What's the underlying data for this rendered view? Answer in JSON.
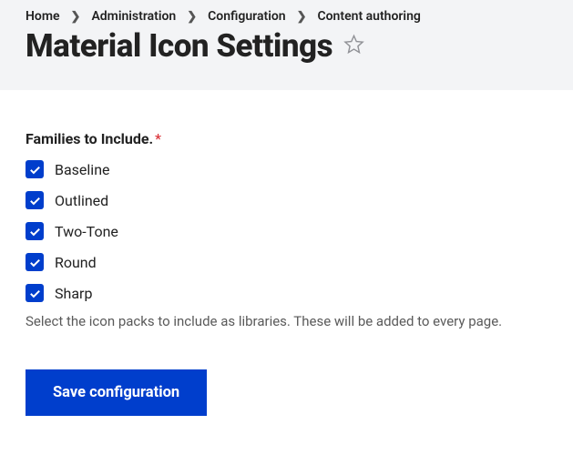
{
  "breadcrumb": [
    "Home",
    "Administration",
    "Configuration",
    "Content authoring"
  ],
  "page_title": "Material Icon Settings",
  "form": {
    "families_label": "Families to Include.",
    "options": [
      {
        "label": "Baseline",
        "checked": true
      },
      {
        "label": "Outlined",
        "checked": true
      },
      {
        "label": "Two-Tone",
        "checked": true
      },
      {
        "label": "Round",
        "checked": true
      },
      {
        "label": "Sharp",
        "checked": true
      }
    ],
    "description": "Select the icon packs to include as libraries. These will be added to every page.",
    "save_label": "Save configuration"
  }
}
